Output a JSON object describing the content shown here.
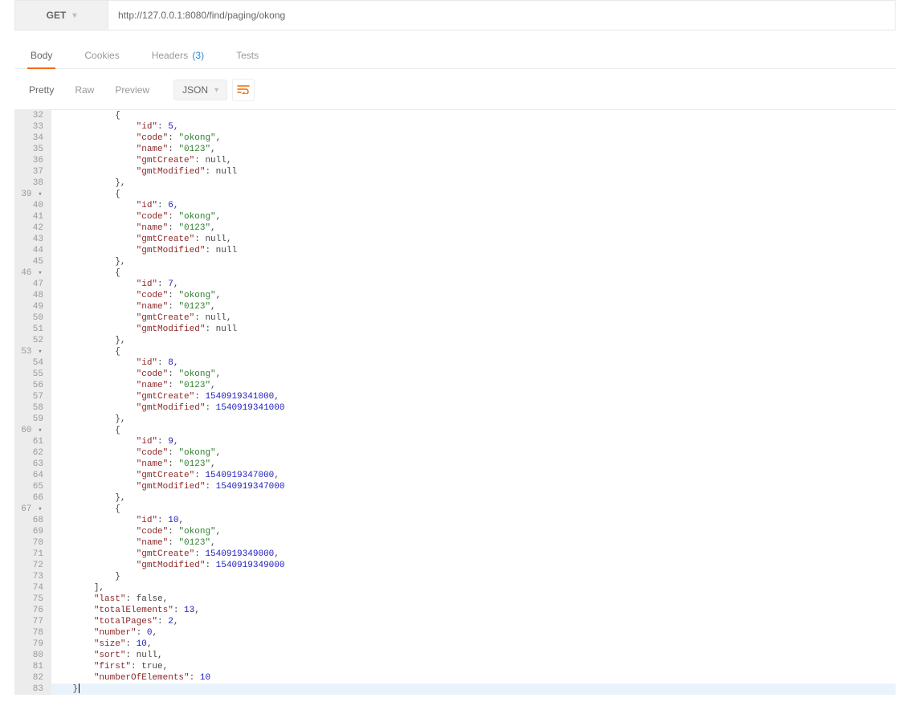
{
  "request": {
    "method": "GET",
    "url": "http://127.0.0.1:8080/find/paging/okong"
  },
  "tabs": {
    "body": "Body",
    "cookies": "Cookies",
    "headers": "Headers",
    "headers_count": "(3)",
    "tests": "Tests",
    "active": "body"
  },
  "viewmodes": {
    "pretty": "Pretty",
    "raw": "Raw",
    "preview": "Preview",
    "format": "JSON"
  },
  "code": {
    "first_line_no": 32,
    "lines": [
      {
        "n": 32,
        "indent": 3,
        "t": "open",
        "text": "{"
      },
      {
        "n": 33,
        "indent": 4,
        "t": "kv",
        "key": "id",
        "vtype": "num",
        "val": "5",
        "comma": true
      },
      {
        "n": 34,
        "indent": 4,
        "t": "kv",
        "key": "code",
        "vtype": "str",
        "val": "okong",
        "comma": true
      },
      {
        "n": 35,
        "indent": 4,
        "t": "kv",
        "key": "name",
        "vtype": "str",
        "val": "0123",
        "comma": true
      },
      {
        "n": 36,
        "indent": 4,
        "t": "kv",
        "key": "gmtCreate",
        "vtype": "null",
        "val": "null",
        "comma": true
      },
      {
        "n": 37,
        "indent": 4,
        "t": "kv",
        "key": "gmtModified",
        "vtype": "null",
        "val": "null",
        "comma": false
      },
      {
        "n": 38,
        "indent": 3,
        "t": "closeopen",
        "text": "},",
        "fold": true
      },
      {
        "n": 39,
        "indent": 3,
        "t": "open",
        "text": "{"
      },
      {
        "n": 40,
        "indent": 4,
        "t": "kv",
        "key": "id",
        "vtype": "num",
        "val": "6",
        "comma": true
      },
      {
        "n": 41,
        "indent": 4,
        "t": "kv",
        "key": "code",
        "vtype": "str",
        "val": "okong",
        "comma": true
      },
      {
        "n": 42,
        "indent": 4,
        "t": "kv",
        "key": "name",
        "vtype": "str",
        "val": "0123",
        "comma": true
      },
      {
        "n": 43,
        "indent": 4,
        "t": "kv",
        "key": "gmtCreate",
        "vtype": "null",
        "val": "null",
        "comma": true
      },
      {
        "n": 44,
        "indent": 4,
        "t": "kv",
        "key": "gmtModified",
        "vtype": "null",
        "val": "null",
        "comma": false
      },
      {
        "n": 45,
        "indent": 3,
        "t": "closeopen",
        "text": "},",
        "fold": true
      },
      {
        "n": 46,
        "indent": 3,
        "t": "open",
        "text": "{"
      },
      {
        "n": 47,
        "indent": 4,
        "t": "kv",
        "key": "id",
        "vtype": "num",
        "val": "7",
        "comma": true
      },
      {
        "n": 48,
        "indent": 4,
        "t": "kv",
        "key": "code",
        "vtype": "str",
        "val": "okong",
        "comma": true
      },
      {
        "n": 49,
        "indent": 4,
        "t": "kv",
        "key": "name",
        "vtype": "str",
        "val": "0123",
        "comma": true
      },
      {
        "n": 50,
        "indent": 4,
        "t": "kv",
        "key": "gmtCreate",
        "vtype": "null",
        "val": "null",
        "comma": true
      },
      {
        "n": 51,
        "indent": 4,
        "t": "kv",
        "key": "gmtModified",
        "vtype": "null",
        "val": "null",
        "comma": false
      },
      {
        "n": 52,
        "indent": 3,
        "t": "closeopen",
        "text": "},",
        "fold": true
      },
      {
        "n": 53,
        "indent": 3,
        "t": "open",
        "text": "{"
      },
      {
        "n": 54,
        "indent": 4,
        "t": "kv",
        "key": "id",
        "vtype": "num",
        "val": "8",
        "comma": true
      },
      {
        "n": 55,
        "indent": 4,
        "t": "kv",
        "key": "code",
        "vtype": "str",
        "val": "okong",
        "comma": true
      },
      {
        "n": 56,
        "indent": 4,
        "t": "kv",
        "key": "name",
        "vtype": "str",
        "val": "0123",
        "comma": true
      },
      {
        "n": 57,
        "indent": 4,
        "t": "kv",
        "key": "gmtCreate",
        "vtype": "num",
        "val": "1540919341000",
        "comma": true
      },
      {
        "n": 58,
        "indent": 4,
        "t": "kv",
        "key": "gmtModified",
        "vtype": "num",
        "val": "1540919341000",
        "comma": false
      },
      {
        "n": 59,
        "indent": 3,
        "t": "closeopen",
        "text": "},",
        "fold": true
      },
      {
        "n": 60,
        "indent": 3,
        "t": "open",
        "text": "{"
      },
      {
        "n": 61,
        "indent": 4,
        "t": "kv",
        "key": "id",
        "vtype": "num",
        "val": "9",
        "comma": true
      },
      {
        "n": 62,
        "indent": 4,
        "t": "kv",
        "key": "code",
        "vtype": "str",
        "val": "okong",
        "comma": true
      },
      {
        "n": 63,
        "indent": 4,
        "t": "kv",
        "key": "name",
        "vtype": "str",
        "val": "0123",
        "comma": true
      },
      {
        "n": 64,
        "indent": 4,
        "t": "kv",
        "key": "gmtCreate",
        "vtype": "num",
        "val": "1540919347000",
        "comma": true
      },
      {
        "n": 65,
        "indent": 4,
        "t": "kv",
        "key": "gmtModified",
        "vtype": "num",
        "val": "1540919347000",
        "comma": false
      },
      {
        "n": 66,
        "indent": 3,
        "t": "closeopen",
        "text": "},",
        "fold": true
      },
      {
        "n": 67,
        "indent": 3,
        "t": "open",
        "text": "{"
      },
      {
        "n": 68,
        "indent": 4,
        "t": "kv",
        "key": "id",
        "vtype": "num",
        "val": "10",
        "comma": true
      },
      {
        "n": 69,
        "indent": 4,
        "t": "kv",
        "key": "code",
        "vtype": "str",
        "val": "okong",
        "comma": true
      },
      {
        "n": 70,
        "indent": 4,
        "t": "kv",
        "key": "name",
        "vtype": "str",
        "val": "0123",
        "comma": true
      },
      {
        "n": 71,
        "indent": 4,
        "t": "kv",
        "key": "gmtCreate",
        "vtype": "num",
        "val": "1540919349000",
        "comma": true
      },
      {
        "n": 72,
        "indent": 4,
        "t": "kv",
        "key": "gmtModified",
        "vtype": "num",
        "val": "1540919349000",
        "comma": false
      },
      {
        "n": 73,
        "indent": 3,
        "t": "close",
        "text": "}"
      },
      {
        "n": 74,
        "indent": 2,
        "t": "close",
        "text": "],"
      },
      {
        "n": 75,
        "indent": 2,
        "t": "kv",
        "key": "last",
        "vtype": "bool",
        "val": "false",
        "comma": true
      },
      {
        "n": 76,
        "indent": 2,
        "t": "kv",
        "key": "totalElements",
        "vtype": "num",
        "val": "13",
        "comma": true
      },
      {
        "n": 77,
        "indent": 2,
        "t": "kv",
        "key": "totalPages",
        "vtype": "num",
        "val": "2",
        "comma": true
      },
      {
        "n": 78,
        "indent": 2,
        "t": "kv",
        "key": "number",
        "vtype": "num",
        "val": "0",
        "comma": true
      },
      {
        "n": 79,
        "indent": 2,
        "t": "kv",
        "key": "size",
        "vtype": "num",
        "val": "10",
        "comma": true
      },
      {
        "n": 80,
        "indent": 2,
        "t": "kv",
        "key": "sort",
        "vtype": "null",
        "val": "null",
        "comma": true
      },
      {
        "n": 81,
        "indent": 2,
        "t": "kv",
        "key": "first",
        "vtype": "bool",
        "val": "true",
        "comma": true
      },
      {
        "n": 82,
        "indent": 2,
        "t": "kv",
        "key": "numberOfElements",
        "vtype": "num",
        "val": "10",
        "comma": false
      },
      {
        "n": 83,
        "indent": 1,
        "t": "close",
        "text": "}",
        "last": true,
        "cursor": true
      }
    ]
  }
}
